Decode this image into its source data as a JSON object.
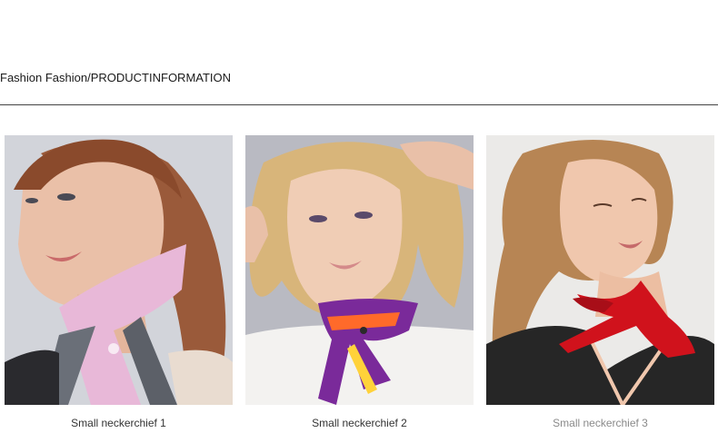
{
  "section": {
    "title": "Fashion Fashion/PRODUCTINFORMATION"
  },
  "products": [
    {
      "caption": "Small neckerchief 1",
      "scarf_color": "#e8b8d8",
      "hair_color": "#9a5a3a"
    },
    {
      "caption": "Small neckerchief 2",
      "scarf_color": "#7a2a9a",
      "hair_color": "#d8b57a"
    },
    {
      "caption": "Small neckerchief 3",
      "scarf_color": "#d0121c",
      "hair_color": "#b78554"
    }
  ]
}
